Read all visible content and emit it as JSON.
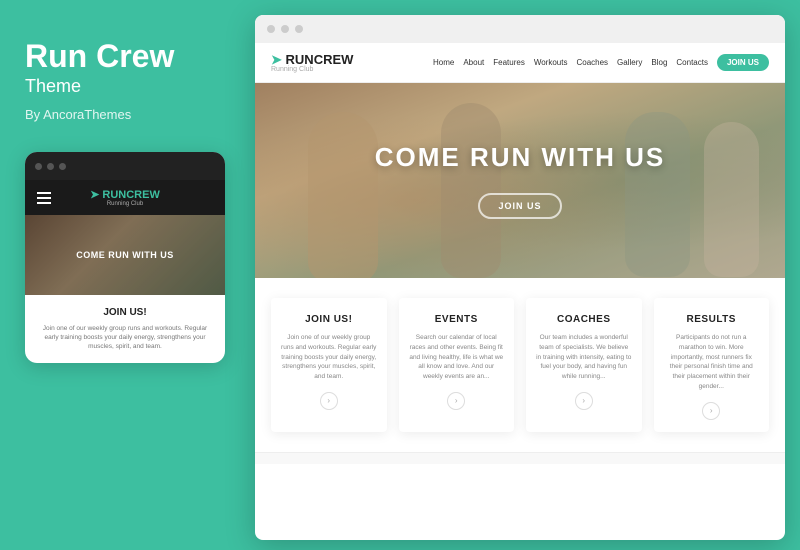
{
  "left": {
    "brand_title": "Run Crew",
    "brand_subtitle": "Theme",
    "by_line": "By AncoraThemes"
  },
  "mobile": {
    "top_bar_dots": [
      "dot1",
      "dot2",
      "dot3"
    ],
    "logo_text": "RUNCREW",
    "logo_sub": "Running Club",
    "hero_text": "COME RUN WITH US",
    "section_title": "JOIN US!",
    "section_text": "Join one of our weekly group runs and workouts. Regular early training boosts your daily energy, strengthens your muscles, spirit, and team."
  },
  "browser": {
    "top_bar_dots": [
      "dot1",
      "dot2",
      "dot3"
    ],
    "nav": {
      "logo": "RUNCREW",
      "logo_sub": "Running Club",
      "links": [
        "Home",
        "About",
        "Features",
        "Workouts",
        "Coaches",
        "Gallery",
        "Blog",
        "Contacts"
      ],
      "join_btn": "JOIN US"
    },
    "hero": {
      "title": "COME RUN WITH US",
      "join_btn": "JOIN US"
    },
    "features": [
      {
        "title": "JOIN US!",
        "text": "Join one of our weekly group runs and workouts. Regular early training boosts your daily energy, strengthens your muscles, spirit, and team."
      },
      {
        "title": "EVENTS",
        "text": "Search our calendar of local races and other events. Being fit and living healthy, life is what we all know and love. And our weekly events are an..."
      },
      {
        "title": "COACHES",
        "text": "Our team includes a wonderful team of specialists. We believe in training with intensity, eating to fuel your body, and having fun while running..."
      },
      {
        "title": "RESULTS",
        "text": "Participants do not run a marathon to win. More importantly, most runners fix their personal finish time and their placement within their gender..."
      }
    ]
  }
}
